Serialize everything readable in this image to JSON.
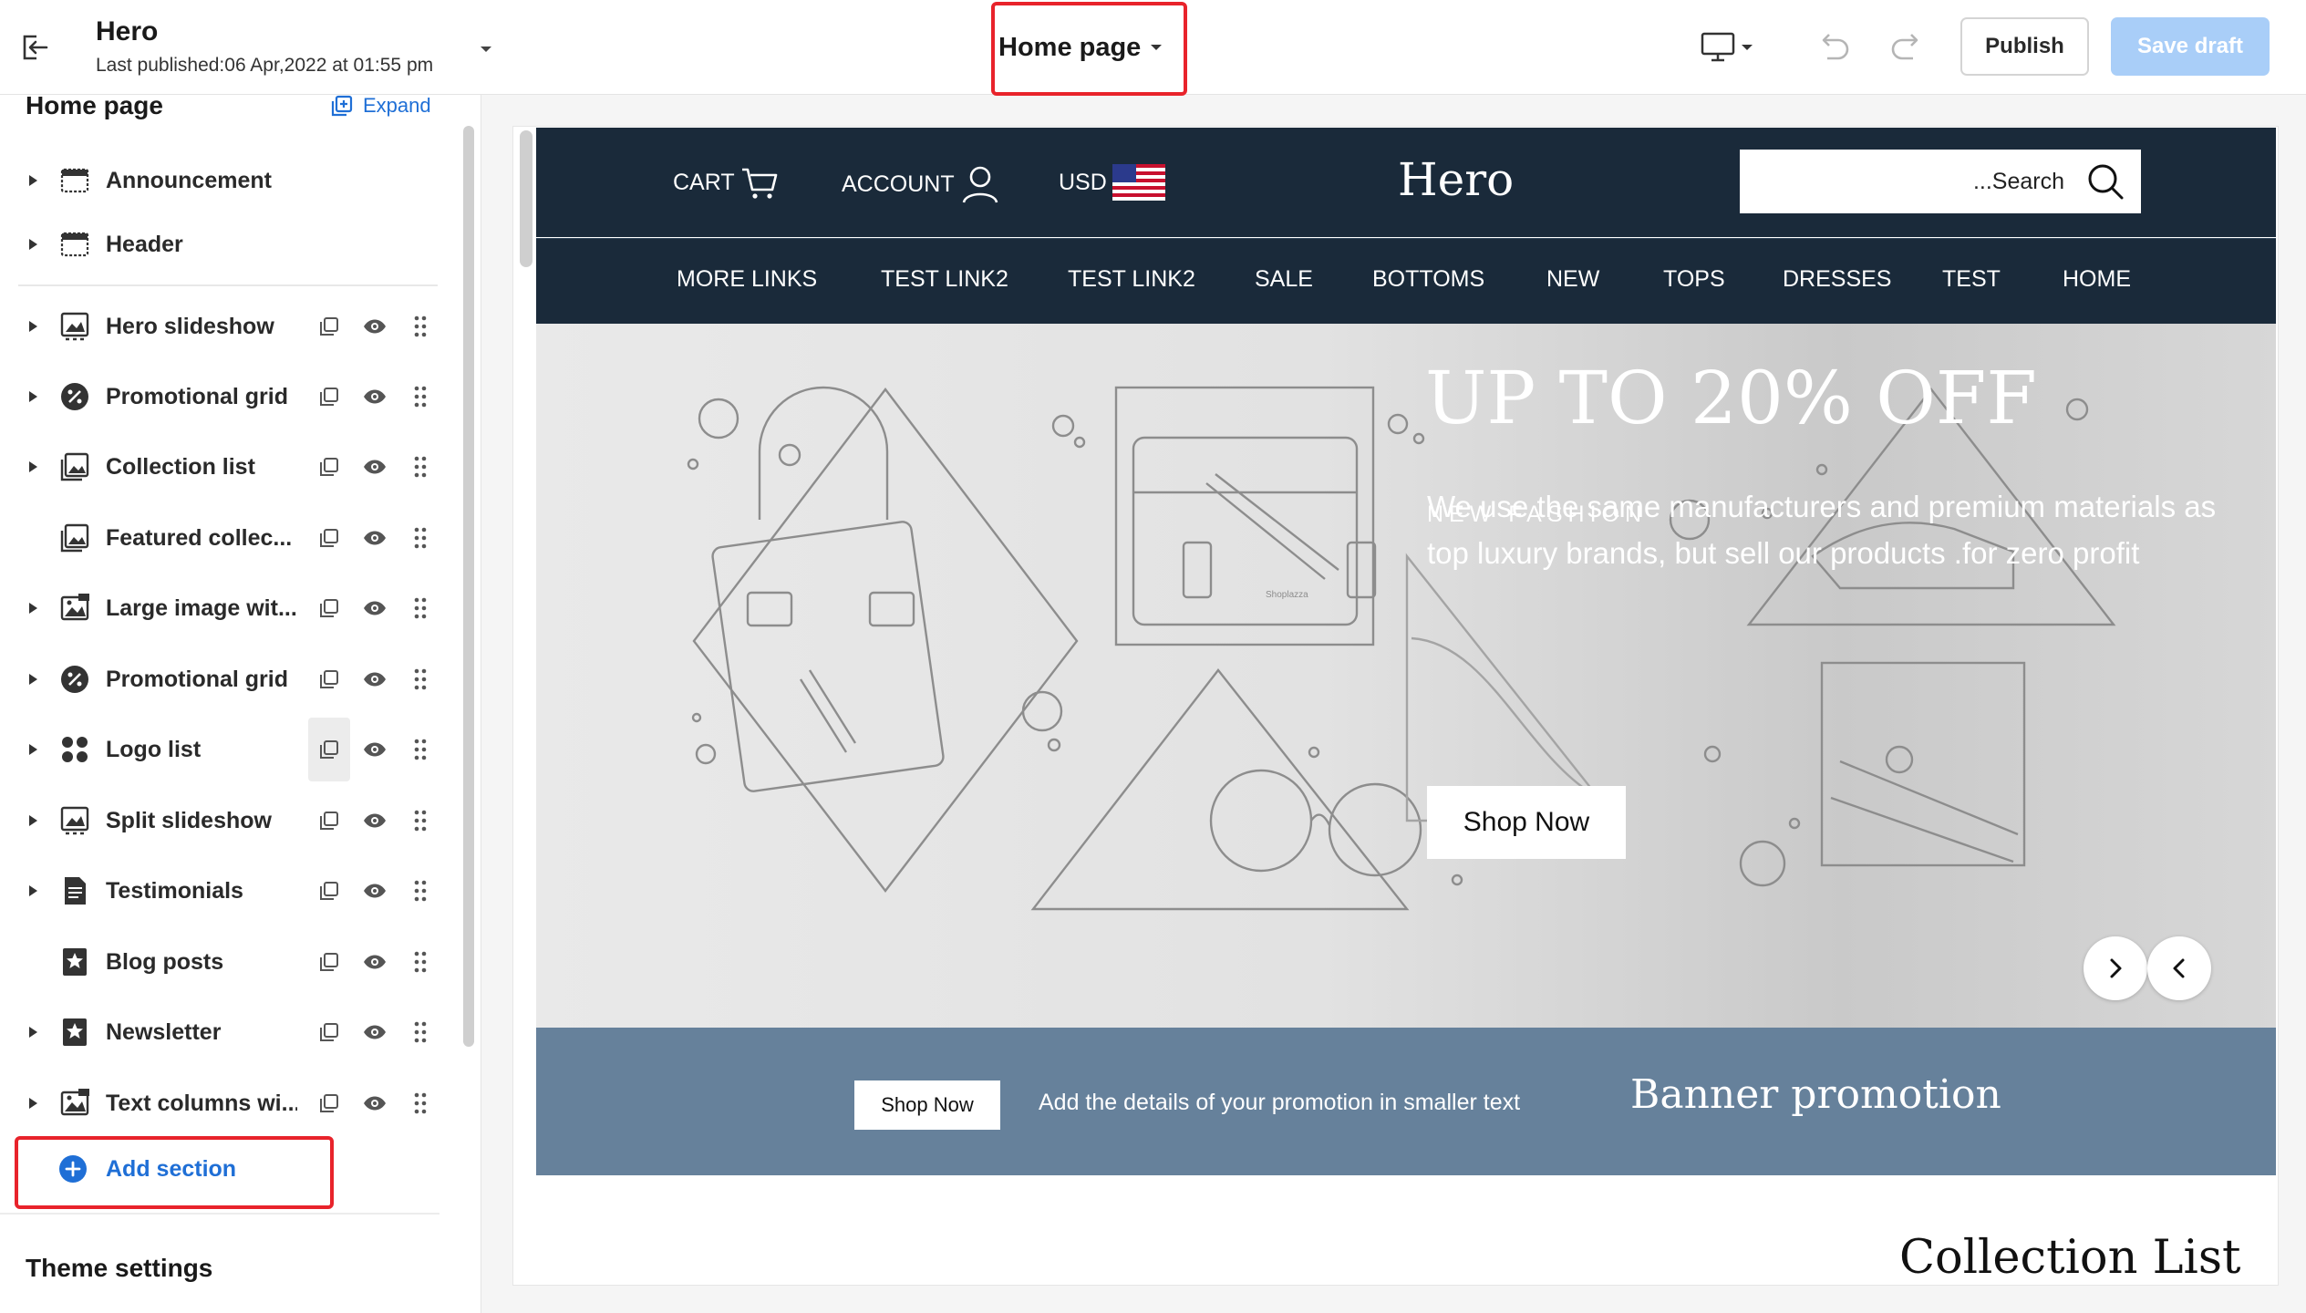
{
  "topbar": {
    "store_name": "Hero",
    "last_published": "Last published:06 Apr,2022 at 01:55 pm",
    "page_select": "Home page",
    "publish_label": "Publish",
    "save_label": "Save draft",
    "icons": [
      "exit-icon",
      "chevron-down-icon",
      "desktop-icon",
      "undo-icon",
      "redo-icon"
    ]
  },
  "sidebar": {
    "title": "Home page",
    "expand_label": "Expand",
    "items": [
      {
        "label": "Announcement",
        "icon": "announcement-icon",
        "expandable": true,
        "actions": false
      },
      {
        "label": "Header",
        "icon": "header-icon",
        "expandable": true,
        "actions": false
      },
      {
        "label": "Hero slideshow",
        "icon": "slideshow-icon",
        "expandable": true,
        "actions": true
      },
      {
        "label": "Promotional grid",
        "icon": "promo-icon",
        "expandable": true,
        "actions": true
      },
      {
        "label": "Collection list",
        "icon": "collection-icon",
        "expandable": true,
        "actions": true
      },
      {
        "label": "Featured collec...",
        "icon": "collection-icon",
        "expandable": false,
        "actions": true
      },
      {
        "label": "Large image wit...",
        "icon": "image-icon",
        "expandable": true,
        "actions": true
      },
      {
        "label": "Promotional grid",
        "icon": "promo-icon",
        "expandable": true,
        "actions": true
      },
      {
        "label": "Logo list",
        "icon": "logo-list-icon",
        "expandable": true,
        "actions": true
      },
      {
        "label": "Split slideshow",
        "icon": "slideshow-icon",
        "expandable": true,
        "actions": true
      },
      {
        "label": "Testimonials",
        "icon": "document-icon",
        "expandable": true,
        "actions": true
      },
      {
        "label": "Blog posts",
        "icon": "star-badge-icon",
        "expandable": false,
        "actions": true
      },
      {
        "label": "Newsletter",
        "icon": "star-badge-icon",
        "expandable": true,
        "actions": true
      },
      {
        "label": "Text columns wi...",
        "icon": "image-icon",
        "expandable": true,
        "actions": true
      }
    ],
    "add_section_label": "Add section",
    "theme_settings_label": "Theme settings"
  },
  "preview": {
    "header": {
      "cart_label": "CART",
      "account_label": "ACCOUNT",
      "currency_label": "USD",
      "logo": "Hero",
      "search_placeholder": "...Search"
    },
    "nav": [
      "MORE LINKS",
      "TEST LINK2",
      "TEST LINK2",
      "SALE",
      "BOTTOMS",
      "NEW",
      "TOPS",
      "DRESSES",
      "TEST",
      "HOME"
    ],
    "hero": {
      "eyebrow": "NEW FASHION",
      "title": "UP TO 20% OFF",
      "description": "We use the same manufacturers and premium materials as top luxury brands, but sell our products .for zero profit",
      "cta": "Shop Now",
      "art_text": "Shoplazza"
    },
    "promo": {
      "button": "Shop Now",
      "text": "Add the details of your promotion in smaller text",
      "title": "Banner promotion"
    },
    "collection_title": "Collection List"
  },
  "colors": {
    "accent": "#1f6fd6",
    "highlight": "#e8232b",
    "site_header": "#1a2a3a",
    "promo_band": "#66819b",
    "save_disabled": "#a9cef8"
  }
}
